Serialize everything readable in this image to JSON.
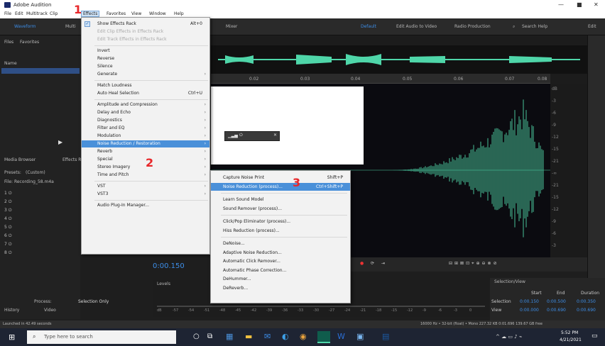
{
  "titlebar": {
    "title": "Adobe Audition"
  },
  "menubar": [
    "File",
    "Edit",
    "Multitrack",
    "Clip",
    "Effects",
    "Favorites",
    "View",
    "Window",
    "Help"
  ],
  "toolbar": {
    "waveform": "Waveform",
    "multitrack": "Multi",
    "default": "Default",
    "edit_audio_video": "Edit Audio to Video",
    "radio_production": "Radio Production",
    "search_help": "Search Help",
    "files_tab": "Files",
    "favorites_tab": "Favorites",
    "name_col": "Name",
    "mixer": "Mixer",
    "editor": "Edit"
  },
  "effects_menu": [
    {
      "label": "Show Effects Rack",
      "shortcut": "Alt+0",
      "checked": true
    },
    {
      "label": "Edit Clip Effects in Effects Rack",
      "disabled": true
    },
    {
      "label": "Edit Track Effects in Effects Rack",
      "disabled": true
    },
    {
      "sep": true
    },
    {
      "label": "Invert"
    },
    {
      "label": "Reverse"
    },
    {
      "label": "Silence"
    },
    {
      "label": "Generate",
      "arrow": true
    },
    {
      "sep": true
    },
    {
      "label": "Match Loudness"
    },
    {
      "label": "Auto Heal Selection",
      "shortcut": "Ctrl+U"
    },
    {
      "sep": true
    },
    {
      "label": "Amplitude and Compression",
      "arrow": true
    },
    {
      "label": "Delay and Echo",
      "arrow": true
    },
    {
      "label": "Diagnostics",
      "arrow": true
    },
    {
      "label": "Filter and EQ",
      "arrow": true
    },
    {
      "label": "Modulation",
      "arrow": true
    },
    {
      "label": "Noise Reduction / Restoration",
      "arrow": true,
      "highlight": true
    },
    {
      "label": "Reverb",
      "arrow": true
    },
    {
      "label": "Special",
      "arrow": true
    },
    {
      "label": "Stereo Imagery",
      "arrow": true
    },
    {
      "label": "Time and Pitch",
      "arrow": true
    },
    {
      "sep": true
    },
    {
      "label": "VST",
      "arrow": true
    },
    {
      "label": "VST3",
      "arrow": true
    },
    {
      "sep": true
    },
    {
      "label": "Audio Plug-In Manager..."
    }
  ],
  "noise_submenu": [
    {
      "label": "Capture Noise Print",
      "shortcut": "Shift+P"
    },
    {
      "label": "Noise Reduction (process)...",
      "shortcut": "Ctrl+Shift+P",
      "highlight": true
    },
    {
      "sep": true
    },
    {
      "label": "Learn Sound Model"
    },
    {
      "label": "Sound Remover (process)..."
    },
    {
      "sep": true
    },
    {
      "label": "Click/Pop Eliminator (process)..."
    },
    {
      "label": "Hiss Reduction (process)..."
    },
    {
      "sep": true
    },
    {
      "label": "DeNoise..."
    },
    {
      "label": "Adaptive Noise Reduction..."
    },
    {
      "label": "Automatic Click Remover..."
    },
    {
      "label": "Automatic Phase Correction..."
    },
    {
      "label": "DeHummer..."
    },
    {
      "label": "DeReverb..."
    }
  ],
  "annotations": [
    "1",
    "2",
    "3"
  ],
  "left_panel": {
    "media_browser": "Media Browser",
    "effects_rack": "Effects Ra",
    "presets": "Presets:",
    "presets_value": "(Custom)",
    "file": "File: Recording_58.m4a",
    "slots": [
      "1",
      "2",
      "3",
      "4",
      "5",
      "6",
      "7",
      "8"
    ],
    "process": "Process:",
    "process_value": "Selection Only",
    "history": "History",
    "video": "Video"
  },
  "ruler_ticks": [
    "0.02",
    "0.03",
    "0.04",
    "0.05",
    "0.06",
    "0.07",
    "0.08"
  ],
  "db_scale": [
    "dB",
    "-3",
    "-6",
    "-9",
    "-12",
    "-15",
    "-21",
    "-∞",
    "-21",
    "-15",
    "-12",
    "-9",
    "-6",
    "-3"
  ],
  "timecode": "0:00.150",
  "levels_title": "Levels",
  "levels_numbers": [
    "dB",
    "-57",
    "-54",
    "-51",
    "-48",
    "-45",
    "-42",
    "-39",
    "-36",
    "-33",
    "-30",
    "-27",
    "-24",
    "-21",
    "-18",
    "-15",
    "-12",
    "-9",
    "-6",
    "-3",
    "0"
  ],
  "selview": {
    "title": "Selection/View",
    "cols": [
      "Start",
      "End",
      "Duration"
    ],
    "rows": [
      {
        "label": "Selection",
        "vals": [
          "0:00.150",
          "0:00.500",
          "0:00.350"
        ]
      },
      {
        "label": "View",
        "vals": [
          "0:00.000",
          "0:00.690",
          "0:00.690"
        ]
      }
    ]
  },
  "status": {
    "left": "Launched in 42.49 seconds",
    "right": "16000 Hz • 32-bit (float) • Mono   227.32 KB   0:01.696   139.67 GB free"
  },
  "taskbar": {
    "search": "Type here to search",
    "time": "5:52 PM",
    "date": "4/21/2021"
  },
  "colors": {
    "waveform": "#4fd6a9",
    "accent": "#3d8ee8",
    "menu_highlight": "#4a90d9",
    "annotation": "#e8272a"
  }
}
